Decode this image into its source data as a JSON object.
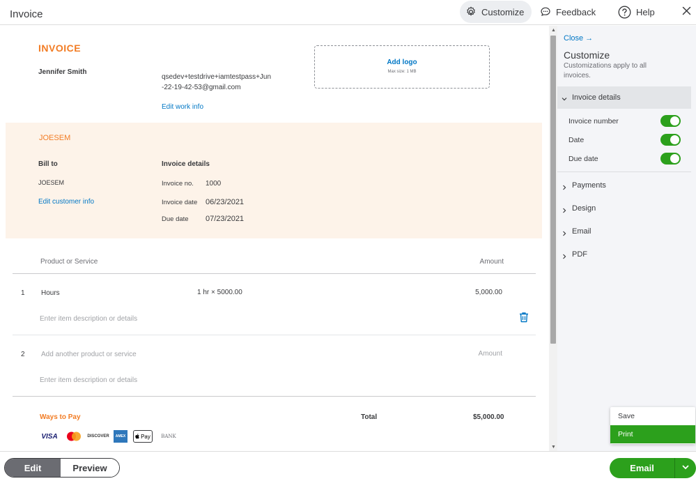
{
  "header": {
    "title": "Invoice",
    "customize_label": "Customize",
    "feedback_label": "Feedback",
    "help_label": "Help"
  },
  "invoice": {
    "title": "INVOICE",
    "company_name": "Jennifer Smith",
    "company_email": "qsedev+testdrive+iamtestpass+Jun-22-19-42-53@gmail.com",
    "edit_work_info": "Edit work info",
    "logo": {
      "add_label": "Add logo",
      "max_size": "Max size: 1 MB"
    },
    "customer": {
      "name": "JOESEM",
      "bill_to_label": "Bill to",
      "bill_to_name": "JOESEM",
      "edit_customer_info": "Edit customer info"
    },
    "details": {
      "title": "Invoice details",
      "number_label": "Invoice no.",
      "number": "1000",
      "date_label": "Invoice date",
      "date": "06/23/2021",
      "due_label": "Due date",
      "due": "07/23/2021"
    },
    "columns": {
      "product": "Product or Service",
      "amount": "Amount"
    },
    "lines": [
      {
        "num": "1",
        "product": "Hours",
        "qty": "1 hr × 5000.00",
        "amount": "5,000.00",
        "description_placeholder": "Enter item description or details"
      },
      {
        "num": "2",
        "product_placeholder": "Add another product or service",
        "amount_placeholder": "Amount",
        "description_placeholder": "Enter item description or details"
      }
    ],
    "ways_to_pay": "Ways to Pay",
    "payment_icons": {
      "visa": "VISA",
      "discover": "DISCOVER",
      "amex": "AMEX",
      "applepay": "Pay",
      "bank": "BANK"
    },
    "total_label": "Total",
    "total_value": "$5,000.00"
  },
  "side": {
    "close_label": "Close →",
    "title": "Customize",
    "subtitle": "Customizations apply to all invoices.",
    "open_section": "Invoice details",
    "toggles": [
      {
        "label": "Invoice number",
        "on": true
      },
      {
        "label": "Date",
        "on": true
      },
      {
        "label": "Due date",
        "on": true
      }
    ],
    "sections": [
      "Payments",
      "Design",
      "Email",
      "PDF"
    ]
  },
  "footer": {
    "edit_label": "Edit",
    "preview_label": "Preview",
    "email_label": "Email"
  },
  "menu": {
    "items": [
      "Save",
      "Print"
    ],
    "selected": "Print"
  },
  "colors": {
    "accent": "#2ca01c",
    "brand_orange": "#f27c24",
    "link": "#0077c5",
    "band": "#fdf3e9"
  }
}
